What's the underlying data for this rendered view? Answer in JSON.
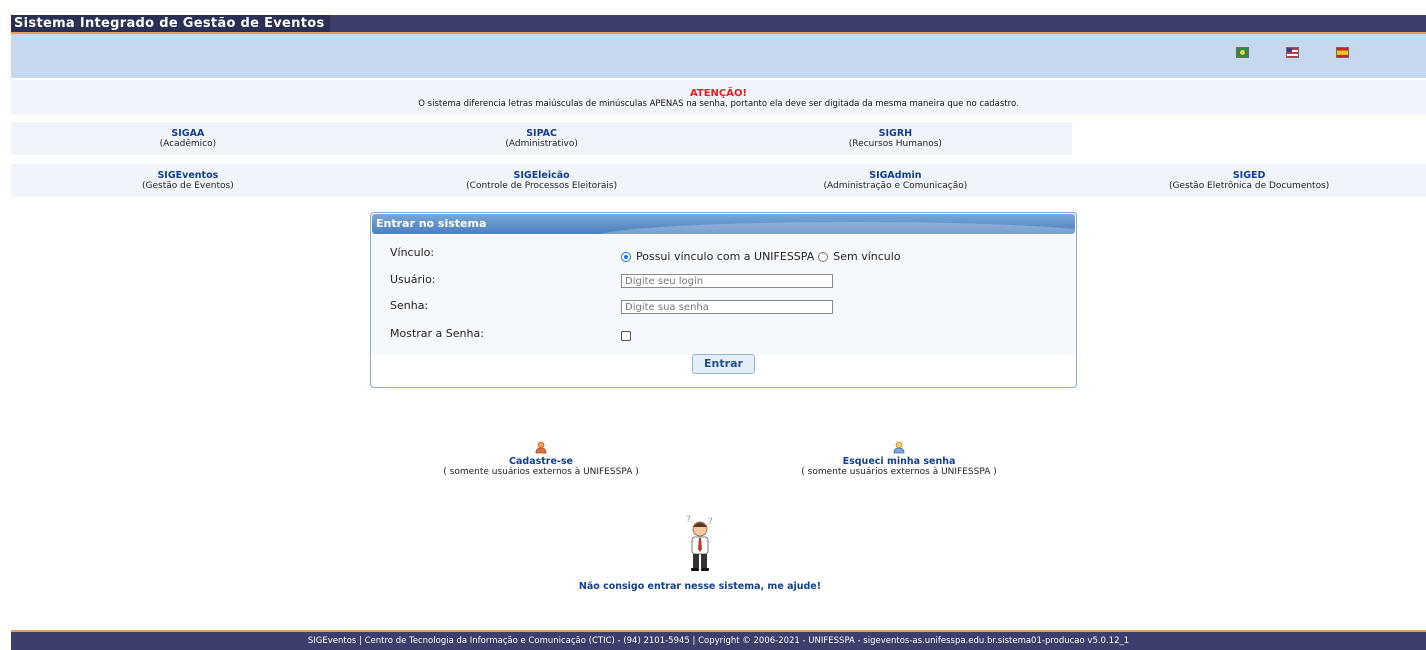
{
  "header": {
    "title": "Sistema Integrado de Gestão de Eventos",
    "flags": [
      "flag-brazil",
      "flag-usa",
      "flag-spain"
    ]
  },
  "attention": {
    "title": "ATENÇÃO!",
    "message": "O sistema diferencia letras maiúsculas de minúsculas APENAS na senha, portanto ela deve ser digitada da mesma maneira que no cadastro."
  },
  "systems_row1": [
    {
      "name": "SIGAA",
      "desc": "(Acadêmico)"
    },
    {
      "name": "SIPAC",
      "desc": "(Administrativo)"
    },
    {
      "name": "SIGRH",
      "desc": "(Recursos Humanos)"
    }
  ],
  "systems_row2": [
    {
      "name": "SIGEventos",
      "desc": "(Gestão de Eventos)"
    },
    {
      "name": "SIGEleicão",
      "desc": "(Controle de Processos Eleitorais)"
    },
    {
      "name": "SIGAdmin",
      "desc": "(Administração e Comunicação)"
    },
    {
      "name": "SIGED",
      "desc": "(Gestão Eletrônica de Documentos)"
    }
  ],
  "login": {
    "header": "Entrar no sistema",
    "vinculo_label": "Vínculo:",
    "option_with": "Possui vínculo com a UNIFESSPA",
    "option_without": "Sem vínculo",
    "selected_option": "Possui vínculo com a UNIFESSPA",
    "user_label": "Usuário:",
    "user_placeholder": "Digite seu login",
    "password_label": "Senha:",
    "password_placeholder": "Digite sua senha",
    "show_password_label": "Mostrar a Senha:",
    "show_password_checked": false,
    "submit_label": "Entrar"
  },
  "links": {
    "register_title": "Cadastre-se",
    "register_sub": "( somente usuários externos à UNIFESSPA )",
    "forgot_title": "Esqueci minha senha",
    "forgot_sub": "( somente usuários externos à UNIFESSPA )",
    "help_text": "Não consigo entrar nesse sistema, me ajude!"
  },
  "footer": {
    "text": "SIGEventos | Centro de Tecnologia da Informação e Comunicação (CTIC) - (94) 2101-5945 | Copyright © 2006-2021 - UNIFESSPA - sigeventos-as.unifesspa.edu.br.sistema01-producao v5.0.12_1"
  },
  "colors": {
    "topbar": "#3c3f6b",
    "accent_orange": "#e6a04c",
    "light_band": "#c7d7ee",
    "link_blue": "#123f8f",
    "attention_red": "#e0211f"
  }
}
